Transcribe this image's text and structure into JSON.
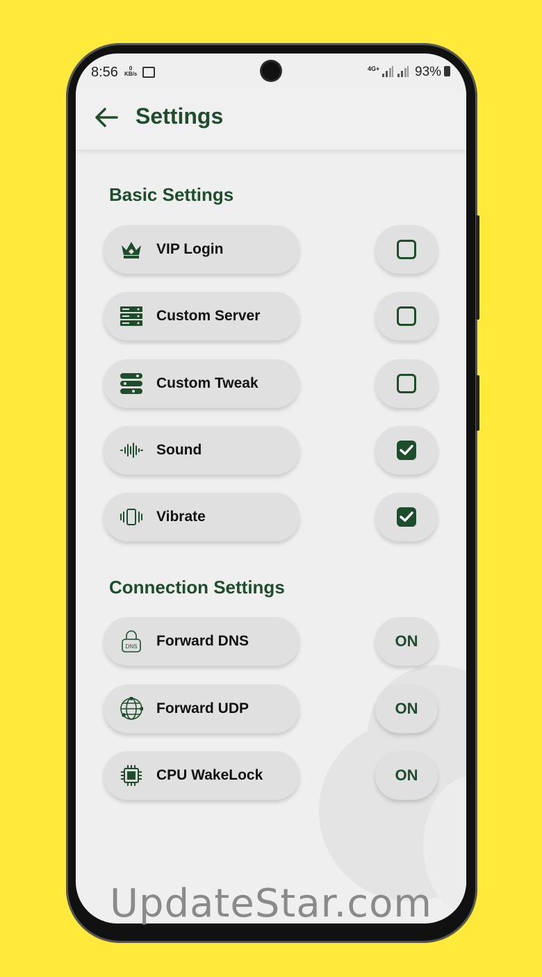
{
  "status_bar": {
    "time": "8:56",
    "data_speed": "0",
    "data_unit": "KB/s",
    "network": "4G+",
    "battery": "93%"
  },
  "app_bar": {
    "title": "Settings"
  },
  "sections": {
    "basic": "Basic Settings",
    "connection": "Connection Settings"
  },
  "basic_items": [
    {
      "label": "VIP Login",
      "icon": "crown-icon",
      "checked": false
    },
    {
      "label": "Custom Server",
      "icon": "server-icon",
      "checked": false
    },
    {
      "label": "Custom Tweak",
      "icon": "tweak-icon",
      "checked": false
    },
    {
      "label": "Sound",
      "icon": "sound-wave-icon",
      "checked": true
    },
    {
      "label": "Vibrate",
      "icon": "vibrate-icon",
      "checked": true
    }
  ],
  "connection_items": [
    {
      "label": "Forward DNS",
      "icon": "dns-lock-icon",
      "state": "ON"
    },
    {
      "label": "Forward UDP",
      "icon": "globe-network-icon",
      "state": "ON"
    },
    {
      "label": "CPU WakeLock",
      "icon": "cpu-chip-icon",
      "state": "ON"
    }
  ],
  "colors": {
    "accent": "#1e4d2b",
    "background": "#ffe93a"
  },
  "watermark": "UpdateStar.com"
}
